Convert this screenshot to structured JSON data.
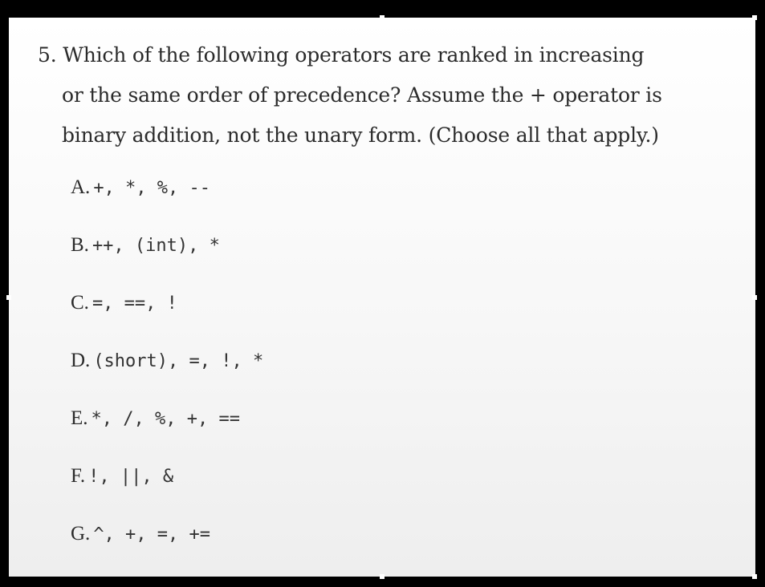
{
  "question": {
    "number": "5.",
    "lines": [
      "Which of the following operators are ranked in increasing",
      "or the same order of precedence? Assume the + operator is",
      "binary addition, not the unary form. (Choose all that apply.)"
    ]
  },
  "options": [
    {
      "letter": "A.",
      "text": "+, *, %, --"
    },
    {
      "letter": "B.",
      "text": "++, (int), *"
    },
    {
      "letter": "C.",
      "text": "=, ==, !"
    },
    {
      "letter": "D.",
      "text": "(short), =, !, *"
    },
    {
      "letter": "E.",
      "text": "*, /, %, +, =="
    },
    {
      "letter": "F.",
      "text": "!, ||, &"
    },
    {
      "letter": "G.",
      "text": "^, +, =, +="
    }
  ]
}
